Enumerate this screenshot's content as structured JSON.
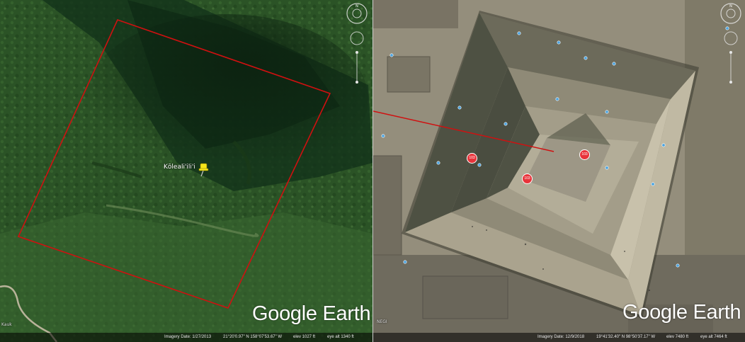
{
  "left_pane": {
    "placemark_label": "Kōleali'ili'i",
    "placemark_icon": "yellow-pushpin-icon",
    "corner_label": "Kauk",
    "brand": "Google Earth",
    "status": {
      "imagery_date": "Imagery Date: 1/27/2013",
      "coordinates": "21°20'0.97\" N  158°07'53.67\" W",
      "elevation": "elev  1027 ft",
      "eye_alt": "eye alt  1340 ft"
    },
    "outline_color": "#d01010"
  },
  "right_pane": {
    "markers": [
      {
        "label": "103"
      },
      {
        "label": "103"
      },
      {
        "label": "103"
      }
    ],
    "corner_label": "NEGI",
    "brand": "Google Earth",
    "status": {
      "imagery_date": "Imagery Date: 12/9/2018",
      "coordinates": "19°41'32.40\" N  98°50'37.17\" W",
      "elevation": "elev  7480 ft",
      "eye_alt": "eye alt  7464 ft"
    },
    "marker_color": "#e8333a",
    "line_color": "#d01010"
  },
  "nav_controls": [
    "look-joystick-icon",
    "move-joystick-icon",
    "zoom-slider"
  ]
}
